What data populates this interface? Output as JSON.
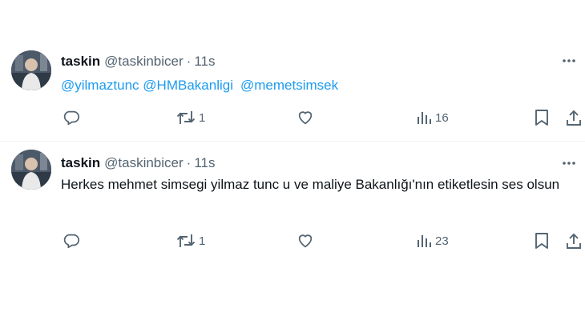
{
  "tweets": [
    {
      "display_name": "taskin",
      "handle": "@taskinbicer",
      "separator": "·",
      "time": "11s",
      "mentions": [
        "@yilmaztunc",
        "@HMBakanligi",
        "@memetsimsek"
      ],
      "text": "",
      "reply_count": "",
      "retweet_count": "1",
      "like_count": "",
      "view_count": "16"
    },
    {
      "display_name": "taskin",
      "handle": "@taskinbicer",
      "separator": "·",
      "time": "11s",
      "mentions": [],
      "text": "Herkes mehmet simsegi yilmaz tunc u ve maliye Bakanlığı'nın etiketlesin ses olsun",
      "reply_count": "",
      "retweet_count": "1",
      "like_count": "",
      "view_count": "23"
    }
  ],
  "icons": {
    "reply": "reply-icon",
    "retweet": "retweet-icon",
    "like": "heart-icon",
    "views": "views-icon",
    "bookmark": "bookmark-icon",
    "share": "share-icon",
    "more": "more-dots-icon"
  },
  "colors": {
    "text": "#0f1419",
    "secondary": "#536471",
    "link": "#1d9bf0",
    "divider": "#eff3f4"
  }
}
